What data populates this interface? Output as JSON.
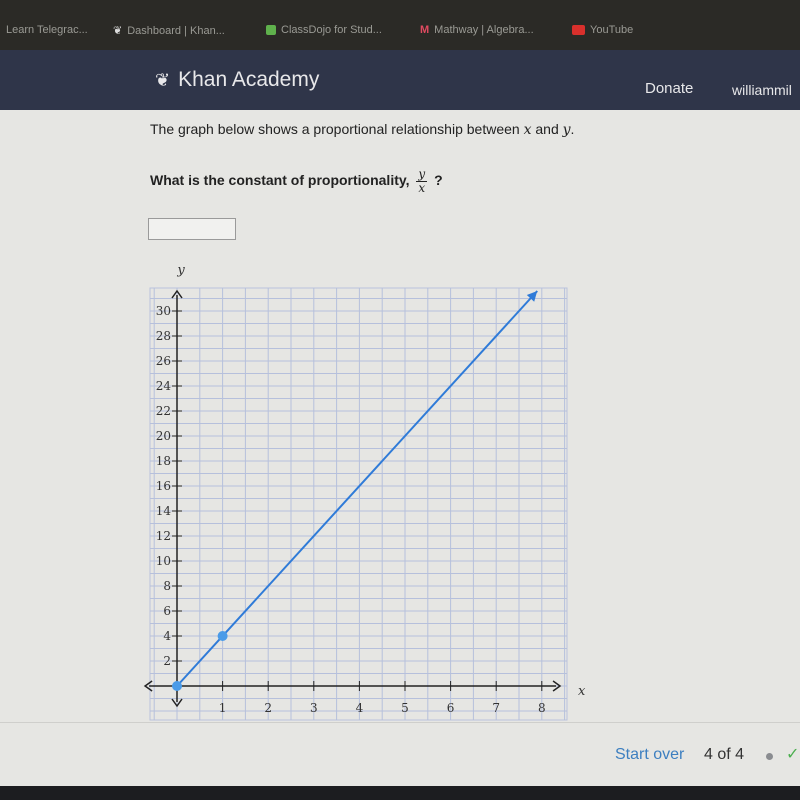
{
  "bookmarks": [
    {
      "label": "Learn Telegrac...",
      "icon": "none"
    },
    {
      "label": "Dashboard | Khan...",
      "icon": "khan-leaf-icon"
    },
    {
      "label": "ClassDojo for Stud...",
      "icon": "classdojo-icon"
    },
    {
      "label": "Mathway | Algebra...",
      "icon": "mathway-icon"
    },
    {
      "label": "YouTube",
      "icon": "youtube-icon"
    }
  ],
  "header": {
    "brand": "Khan Academy",
    "donate": "Donate",
    "user": "williammil"
  },
  "question": {
    "line1_pre": "The graph below shows a proportional relationship between ",
    "var_x": "x",
    "and": " and ",
    "var_y": "y",
    "period": ".",
    "line2": "What is the constant of proportionality, ",
    "frac_num": "y",
    "frac_den": "x",
    "qmark": " ?",
    "answer_value": ""
  },
  "graph": {
    "x_label": "x",
    "y_label": "y",
    "x_ticks": [
      "1",
      "2",
      "3",
      "4",
      "5",
      "6",
      "7",
      "8"
    ],
    "y_ticks": [
      "2",
      "4",
      "6",
      "8",
      "10",
      "12",
      "14",
      "16",
      "18",
      "20",
      "22",
      "24",
      "26",
      "28",
      "30"
    ],
    "x_range": [
      -0.7,
      8.4
    ],
    "y_range": [
      -1.6,
      31.6
    ],
    "line": {
      "slope": 4,
      "from": [
        0,
        0
      ],
      "to": [
        7.9,
        31.6
      ],
      "color": "#2f7bd8"
    },
    "points": [
      [
        0,
        0
      ],
      [
        1,
        4
      ]
    ],
    "point_color": "#4a9be8"
  },
  "footer": {
    "start_over": "Start over",
    "progress": "4 of 4"
  }
}
